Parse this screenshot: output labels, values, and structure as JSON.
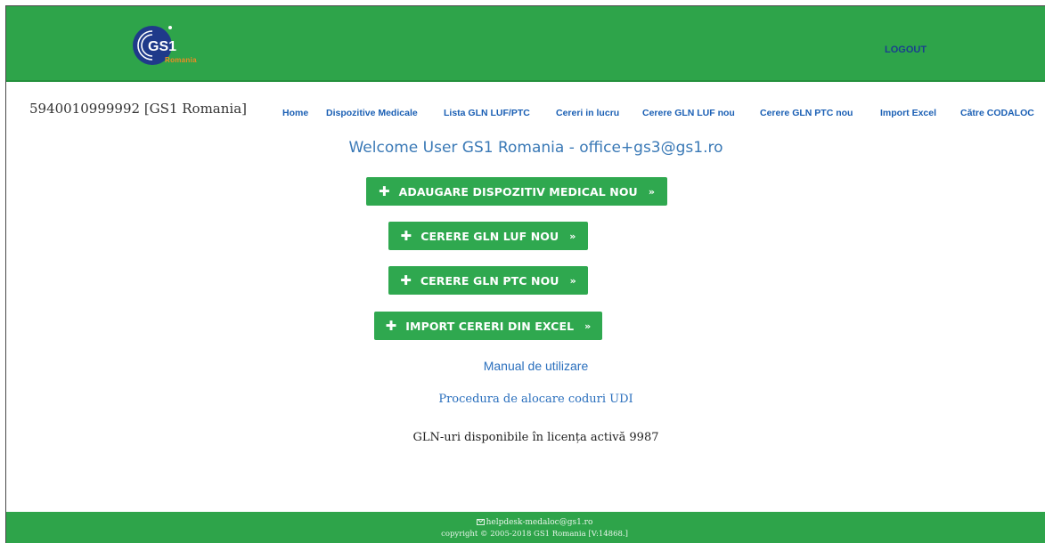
{
  "header": {
    "logo_text": "GS1",
    "logo_sub": "Romania",
    "logout_label": "LOGOUT"
  },
  "org": {
    "id_label": "5940010999992 [GS1 Romania]"
  },
  "nav": {
    "items": [
      {
        "label": "Home"
      },
      {
        "label": "Dispozitive Medicale"
      },
      {
        "label": "Lista GLN LUF/PTC"
      },
      {
        "label": "Cereri in lucru"
      },
      {
        "label": "Cerere GLN LUF nou"
      },
      {
        "label": "Cerere GLN PTC nou"
      },
      {
        "label": "Import Excel"
      },
      {
        "label": "Către CODALOC"
      }
    ]
  },
  "main": {
    "welcome": "Welcome User GS1 Romania - office+gs3@gs1.ro",
    "buttons": [
      {
        "label": "ADAUGARE DISPOZITIV MEDICAL NOU"
      },
      {
        "label": "CERERE GLN LUF NOU"
      },
      {
        "label": "CERERE GLN PTC NOU"
      },
      {
        "label": "IMPORT CERERI DIN EXCEL"
      }
    ],
    "manual_link": "Manual de utilizare",
    "procedure_link": "Procedura de alocare coduri UDI",
    "gln_info_label": "GLN-uri disponibile în licența activă",
    "gln_info_count": "9987"
  },
  "footer": {
    "email": "helpdesk-medaloc@gs1.ro",
    "copyright": "copyright © 2005-2018 GS1 Romania [V:14868.]"
  },
  "colors": {
    "header_green": "#2ea44a",
    "button_green": "#2fa84f",
    "link_blue": "#1a5fb4",
    "welcome_blue": "#3a79b6",
    "logout_blue": "#1a3f8f",
    "logo_accent": "#f08a24"
  },
  "icons": {
    "plus": "plus-icon",
    "chevron": "double-chevron-right-icon",
    "mail": "envelope-icon"
  }
}
